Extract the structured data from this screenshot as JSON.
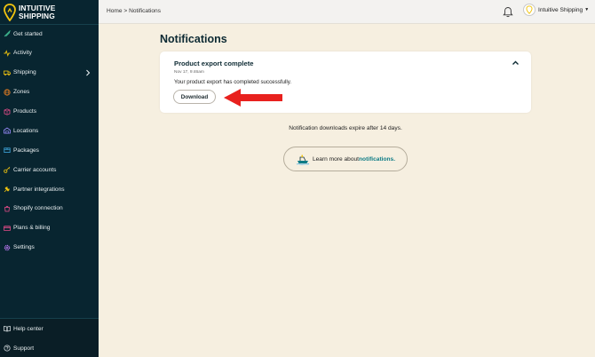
{
  "brand": {
    "line1": "INTUITIVE",
    "line2": "SHIPPING"
  },
  "sidebar": {
    "items": [
      {
        "label": "Get started",
        "icon": "rocket-icon"
      },
      {
        "label": "Activity",
        "icon": "activity-icon"
      },
      {
        "label": "Shipping",
        "icon": "truck-icon"
      },
      {
        "label": "Zones",
        "icon": "globe-icon"
      },
      {
        "label": "Products",
        "icon": "product-icon"
      },
      {
        "label": "Locations",
        "icon": "warehouse-icon"
      },
      {
        "label": "Packages",
        "icon": "package-icon"
      },
      {
        "label": "Carrier accounts",
        "icon": "key-icon"
      },
      {
        "label": "Partner integrations",
        "icon": "plug-icon"
      },
      {
        "label": "Shopify connection",
        "icon": "shopify-icon"
      },
      {
        "label": "Plans & billing",
        "icon": "card-icon"
      },
      {
        "label": "Settings",
        "icon": "gear-icon"
      }
    ],
    "bottom": [
      {
        "label": "Help center",
        "icon": "book-icon"
      },
      {
        "label": "Support",
        "icon": "help-icon"
      }
    ]
  },
  "topbar": {
    "breadcrumb": "Home > Notifications",
    "user_name": "Intuitive Shipping"
  },
  "main": {
    "title": "Notifications",
    "notification": {
      "title": "Product export complete",
      "timestamp": "Nov 17, 9:46am",
      "message": "Your product export has completed successfully.",
      "button": "Download"
    },
    "expire_note": "Notification downloads expire after 14 days.",
    "learn_prefix": "Learn more about ",
    "learn_link": "notifications."
  },
  "colors": {
    "sidebar_bg": "#082530",
    "page_bg": "#f6efe0",
    "accent_yellow": "#f1c40f",
    "accent_teal": "#0e7c86",
    "arrow_red": "#e8211e"
  }
}
